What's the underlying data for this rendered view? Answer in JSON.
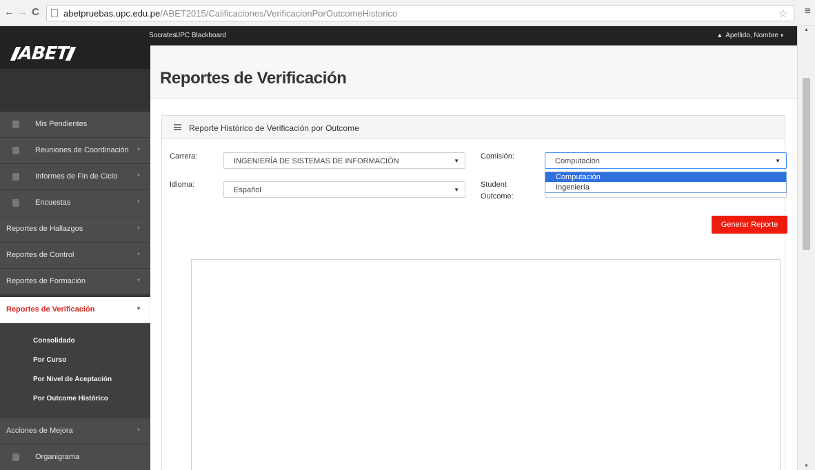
{
  "browser": {
    "url_domain": "abetpruebas.upc.edu.pe",
    "url_path": "/ABET2015/Calificaciones/VerificacionPorOutcomeHistorico"
  },
  "topbar": {
    "links": [
      "Socrates",
      "UPC Blackboard"
    ],
    "user": "Apellido, Nombre"
  },
  "logo": {
    "left": "",
    "right": "ABET"
  },
  "sidebar": {
    "items": [
      {
        "label": "Mis Pendientes"
      },
      {
        "label": "Reuniones de Coordinación"
      },
      {
        "label": "Informes de Fin de Ciclo"
      },
      {
        "label": "Encuestas"
      },
      {
        "label": "Reportes de Hallazgos"
      },
      {
        "label": "Reportes de Control"
      },
      {
        "label": "Reportes de Formación"
      },
      {
        "label": "Reportes de Verificación"
      },
      {
        "label": "Acciones de Mejora"
      },
      {
        "label": "Organigrama"
      }
    ],
    "submenu": [
      "Consolidado",
      "Por Curso",
      "Por Nivel de Aceptación",
      "Por Outcome Histórico"
    ]
  },
  "page": {
    "title": "Reportes de Verificación",
    "panel_title": "Reporte Histórico de Verificación por Outcome"
  },
  "form": {
    "carrera_label": "Carrera:",
    "carrera_value": "INGENIERÍA DE SISTEMAS DE INFORMACIÓN",
    "idioma_label": "Idioma:",
    "idioma_value": "Español",
    "comision_label": "Comisión:",
    "comision_value": "Computación",
    "comision_options": [
      "Computación",
      "Ingeniería"
    ],
    "student_outcome_label": [
      "Student",
      "Outcome:"
    ],
    "generate_button": "Generar Reporte"
  },
  "colors": {
    "accent_red": "#ed1c0e",
    "active_text": "#d9261c",
    "sidebar_bg": "#4c4c4c",
    "dropdown_selected": "#2f6fe0"
  }
}
